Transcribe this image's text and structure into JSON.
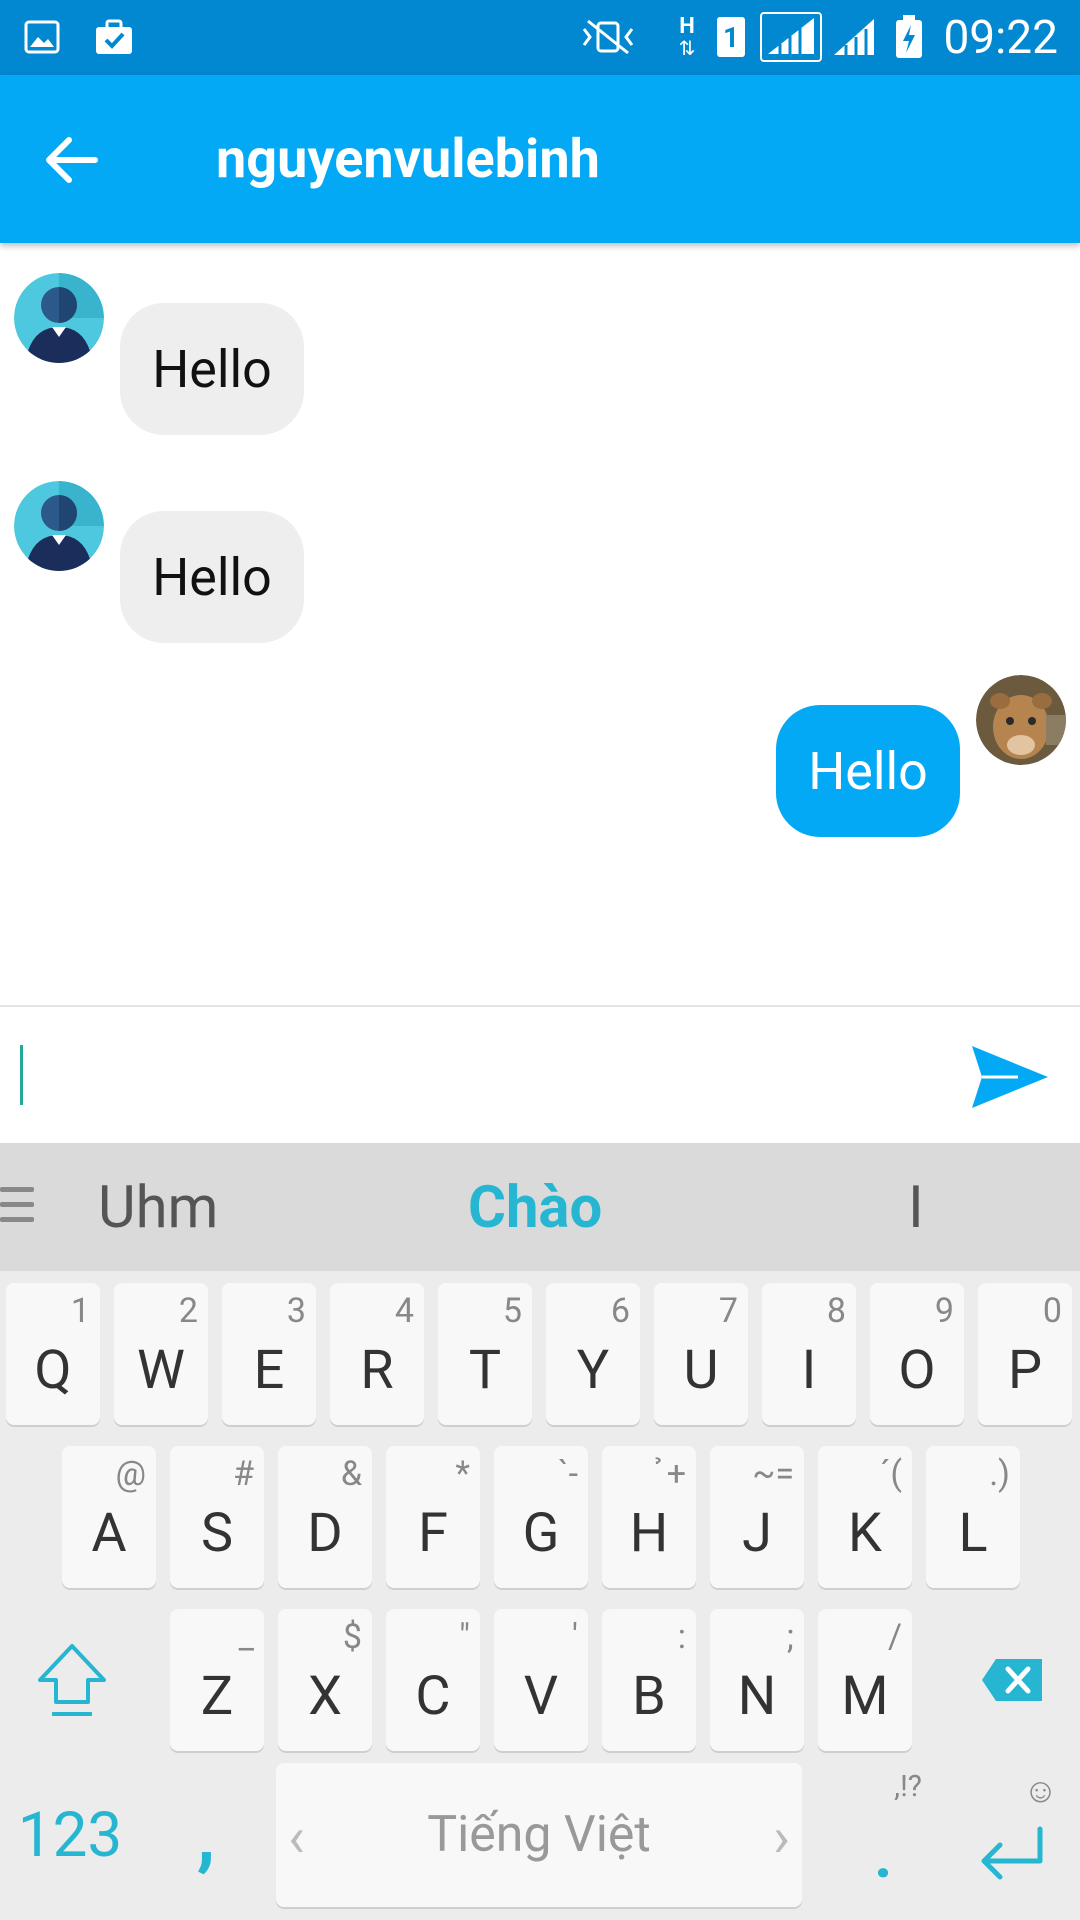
{
  "status_bar": {
    "time": "09:22",
    "network_indicator": "H",
    "sim_slot": "1"
  },
  "header": {
    "title": "nguyenvulebinh",
    "back_icon": "arrow-back-icon"
  },
  "messages": [
    {
      "direction": "incoming",
      "text": "Hello"
    },
    {
      "direction": "incoming",
      "text": "Hello"
    },
    {
      "direction": "outgoing",
      "text": "Hello"
    }
  ],
  "composer": {
    "value": "",
    "send_icon": "send-icon"
  },
  "keyboard": {
    "suggestions": [
      "Uhm",
      "Chào",
      "I"
    ],
    "row1": [
      {
        "key": "Q",
        "alt": "1"
      },
      {
        "key": "W",
        "alt": "2"
      },
      {
        "key": "E",
        "alt": "3"
      },
      {
        "key": "R",
        "alt": "4"
      },
      {
        "key": "T",
        "alt": "5"
      },
      {
        "key": "Y",
        "alt": "6"
      },
      {
        "key": "U",
        "alt": "7"
      },
      {
        "key": "I",
        "alt": "8"
      },
      {
        "key": "O",
        "alt": "9"
      },
      {
        "key": "P",
        "alt": "0"
      }
    ],
    "row2": [
      {
        "key": "A",
        "alt": "@"
      },
      {
        "key": "S",
        "alt": "#"
      },
      {
        "key": "D",
        "alt": "&"
      },
      {
        "key": "F",
        "alt": "*"
      },
      {
        "key": "G",
        "alt": "`-"
      },
      {
        "key": "H",
        "alt": "̉+"
      },
      {
        "key": "J",
        "alt": "~="
      },
      {
        "key": "K",
        "alt": "´("
      },
      {
        "key": "L",
        "alt": ".)"
      }
    ],
    "row3": [
      {
        "key": "Z",
        "alt": "_"
      },
      {
        "key": "X",
        "alt": "$"
      },
      {
        "key": "C",
        "alt": "\""
      },
      {
        "key": "V",
        "alt": "'"
      },
      {
        "key": "B",
        "alt": ":"
      },
      {
        "key": "N",
        "alt": ";"
      },
      {
        "key": "M",
        "alt": "/"
      }
    ],
    "numbers_label": "123",
    "comma_label": ",",
    "space_label": "Tiếng Việt",
    "period_label": ".",
    "period_alt": ",!?",
    "colors": {
      "accent": "#26b6d2",
      "app_bar": "#03a9f4",
      "status_bar": "#0288d1"
    }
  }
}
